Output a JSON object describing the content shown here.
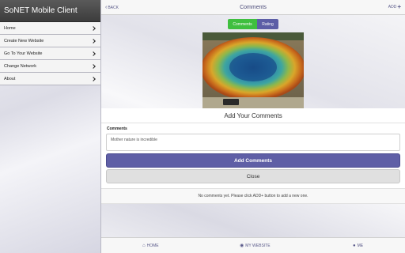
{
  "sidebar": {
    "title": "SoNET Mobile Client",
    "items": [
      {
        "label": "Home"
      },
      {
        "label": "Create New Website"
      },
      {
        "label": "Go To Your Website"
      },
      {
        "label": "Change Network"
      },
      {
        "label": "About"
      }
    ]
  },
  "header": {
    "back_label": "BACK",
    "title": "Comments",
    "add_label": "ADD"
  },
  "tabs": [
    {
      "label": "Comments",
      "active": true
    },
    {
      "label": "Rating",
      "active": false
    }
  ],
  "comment_form": {
    "heading": "Add Your Comments",
    "field_label": "Comments",
    "input_value": "Mother nature is incredible",
    "add_button": "Add Comments",
    "close_button": "Close"
  },
  "empty_message": "No comments yet. Please click ADD+ button to add a new one.",
  "bottom_nav": {
    "home": "HOME",
    "website": "MY WEBSITE",
    "me": "ME"
  },
  "icons": {
    "back": "chevron-left-icon",
    "add": "plus-icon",
    "home": "home-icon",
    "website": "globe-icon",
    "me": "user-icon",
    "menu": "chevron-right-icon"
  },
  "colors": {
    "accent": "#5f5fa6",
    "active_tab": "#3fbf3f",
    "header_dark": "#3c3c3c"
  }
}
